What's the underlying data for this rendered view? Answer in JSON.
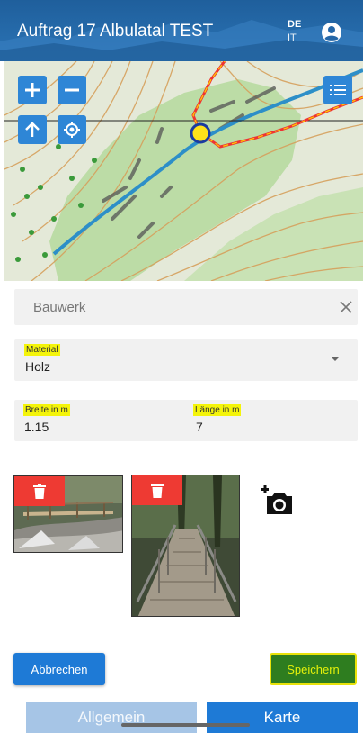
{
  "header": {
    "title": "Auftrag 17 Albulatal TEST",
    "lang_active": "DE",
    "lang_other": "IT",
    "account_icon": "account-circle-icon"
  },
  "map": {
    "controls": [
      "zoom-in-icon",
      "zoom-out-icon",
      "north-arrow-icon",
      "locate-icon",
      "layers-list-icon"
    ],
    "basemap_thumbs": [
      "basemap-topo",
      "basemap-sketch",
      "basemap-aerial"
    ],
    "thumb_mark": "*"
  },
  "form": {
    "search_placeholder": "Bauwerk",
    "material_label": "Material",
    "material_value": "Holz",
    "width_label": "Breite in m",
    "width_value": "1.15",
    "length_label": "Länge in m",
    "length_value": "7"
  },
  "photos": {
    "delete_icon": "trash-icon",
    "add_icon": "add-photo-icon"
  },
  "actions": {
    "cancel_label": "Abbrechen",
    "save_label": "Speichern"
  },
  "tabs": {
    "general_label": "Allgemein",
    "map_label": "Karte"
  },
  "colors": {
    "primary": "#1e7ad6",
    "save_bg": "#2e7d1f",
    "highlight": "#f4f40a",
    "delete": "#ee3a33"
  }
}
